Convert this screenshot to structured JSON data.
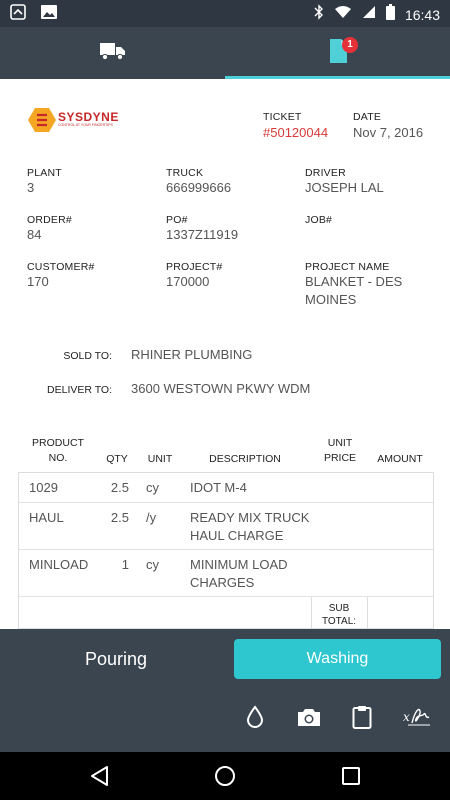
{
  "status_bar": {
    "time": "16:43",
    "icons": [
      "notification-icon",
      "image-icon",
      "bluetooth-icon",
      "wifi-icon",
      "signal-icon",
      "battery-icon"
    ]
  },
  "tabs": [
    {
      "icon": "truck-icon",
      "selected": false
    },
    {
      "icon": "document-icon",
      "selected": true,
      "badge": "1"
    }
  ],
  "ticket": {
    "logo": {
      "brand": "SYSDYNE",
      "tagline": "CONTROL AT YOUR FINGERTIPS"
    },
    "ticket_label": "TICKET",
    "ticket_number": "#50120044",
    "date_label": "DATE",
    "date": "Nov 7, 2016",
    "fields": {
      "plant_label": "PLANT",
      "plant": "3",
      "truck_label": "TRUCK",
      "truck": "666999666",
      "driver_label": "DRIVER",
      "driver": "JOSEPH LAL",
      "order_label": "ORDER#",
      "order": "84",
      "po_label": "PO#",
      "po": "1337Z11919",
      "job_label": "JOB#",
      "job": "",
      "customer_label": "CUSTOMER#",
      "customer": "170",
      "project_label": "PROJECT#",
      "project": "170000",
      "project_name_label": "PROJECT NAME",
      "project_name_1": "BLANKET - DES",
      "project_name_2": "MOINES"
    },
    "sold_to_label": "SOLD TO:",
    "sold_to": "RHINER PLUMBING",
    "deliver_to_label": "DELIVER TO:",
    "deliver_to": "3600 WESTOWN PKWY WDM",
    "table": {
      "headers": {
        "product_1": "PRODUCT",
        "product_2": "NO.",
        "qty": "QTY",
        "unit": "UNIT",
        "description": "DESCRIPTION",
        "unit_price_1": "UNIT",
        "unit_price_2": "PRICE",
        "amount": "AMOUNT"
      },
      "rows": [
        {
          "product": "1029",
          "qty": "2.5",
          "unit": "cy",
          "desc_1": "IDOT M-4",
          "desc_2": ""
        },
        {
          "product": "HAUL",
          "qty": "2.5",
          "unit": "/y",
          "desc_1": "READY MIX TRUCK",
          "desc_2": "HAUL CHARGE"
        },
        {
          "product": "MINLOAD",
          "qty": "1",
          "unit": "cy",
          "desc_1": "MINIMUM LOAD",
          "desc_2": "CHARGES"
        }
      ],
      "subtotal_1": "SUB",
      "subtotal_2": "TOTAL:"
    }
  },
  "actions": {
    "pouring": "Pouring",
    "washing": "Washing",
    "tools": [
      "water-drop-icon",
      "camera-icon",
      "clipboard-icon",
      "signature-icon"
    ],
    "accent": "#2ec7d0"
  },
  "colors": {
    "header_bg": "#3b4550",
    "status_bg": "#2e3742",
    "ticket_red": "#d93a3a",
    "badge_red": "#e53238"
  }
}
